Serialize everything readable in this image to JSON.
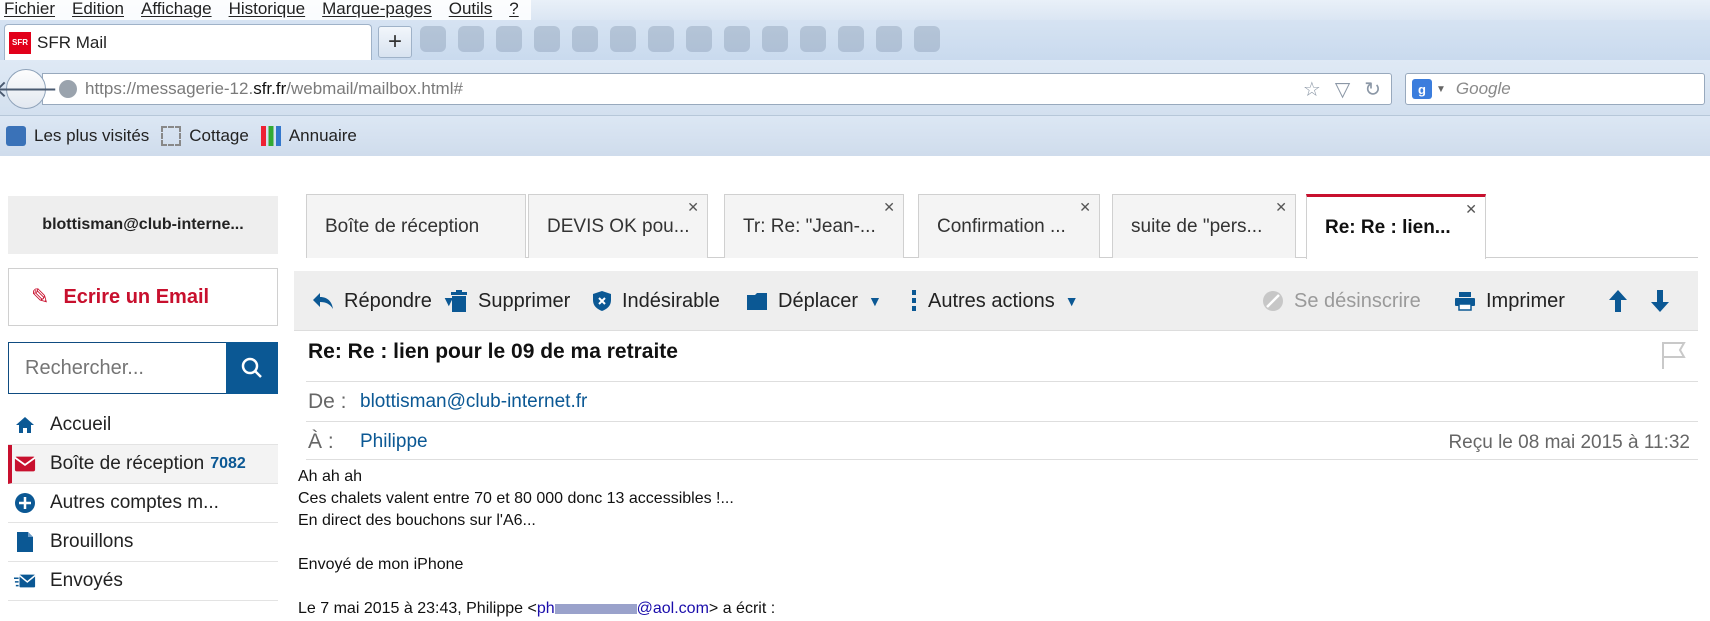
{
  "browser": {
    "menu": [
      "Fichier",
      "Edition",
      "Affichage",
      "Historique",
      "Marque-pages",
      "Outils",
      "?"
    ],
    "tab_title": "SFR Mail",
    "logo_text": "SFR",
    "newtab": "+",
    "url_prefix": "https://messagerie-12.",
    "url_domain": "sfr.fr",
    "url_suffix": "/webmail/mailbox.html#",
    "search_placeholder": "Google",
    "bookmarks": [
      "Les plus visités",
      "Cottage",
      "Annuaire"
    ]
  },
  "sidebar": {
    "account": "blottisman@club-interne...",
    "write_label": "Ecrire un Email",
    "search_placeholder": "Rechercher...",
    "folders": [
      {
        "label": "Accueil",
        "icon": "home-icon"
      },
      {
        "label": "Boîte de réception",
        "count": "7082",
        "icon": "inbox-icon"
      },
      {
        "label": "Autres comptes m...",
        "icon": "plus-circle-icon"
      },
      {
        "label": "Brouillons",
        "icon": "draft-icon"
      },
      {
        "label": "Envoyés",
        "icon": "sent-icon"
      }
    ]
  },
  "tabs": [
    {
      "label": "Boîte de réception",
      "closable": false
    },
    {
      "label": "DEVIS OK pou...",
      "closable": true
    },
    {
      "label": "Tr: Re: \"Jean-...",
      "closable": true
    },
    {
      "label": "Confirmation ...",
      "closable": true
    },
    {
      "label": "suite de \"pers...",
      "closable": true
    },
    {
      "label": "Re: Re : lien...",
      "closable": true,
      "active": true
    }
  ],
  "actions": {
    "reply": "Répondre",
    "delete": "Supprimer",
    "spam": "Indésirable",
    "move": "Déplacer",
    "more": "Autres actions",
    "unsubscribe": "Se désinscrire",
    "print": "Imprimer"
  },
  "message": {
    "subject": "Re: Re : lien pour le 09 de ma retraite",
    "from_label": "De :",
    "from": "blottisman@club-internet.fr",
    "to_label": "À :",
    "to": "Philippe",
    "received": "Reçu le 08 mai 2015 à 11:32",
    "body": {
      "line1": "Ah ah ah",
      "line2": "Ces chalets valent entre 70 et 80 000 donc 13 accessibles !...",
      "line3": "En direct des bouchons sur l'A6...",
      "line4": "Envoyé de mon iPhone",
      "quote_prefix": "Le 7 mai 2015 à 23:43, Philippe <",
      "quote_email_start": "ph",
      "quote_email_end": "@aol.com",
      "quote_suffix": "> a écrit :"
    }
  },
  "colors": {
    "accent_red": "#c8102e",
    "brand_blue": "#0b5894"
  }
}
